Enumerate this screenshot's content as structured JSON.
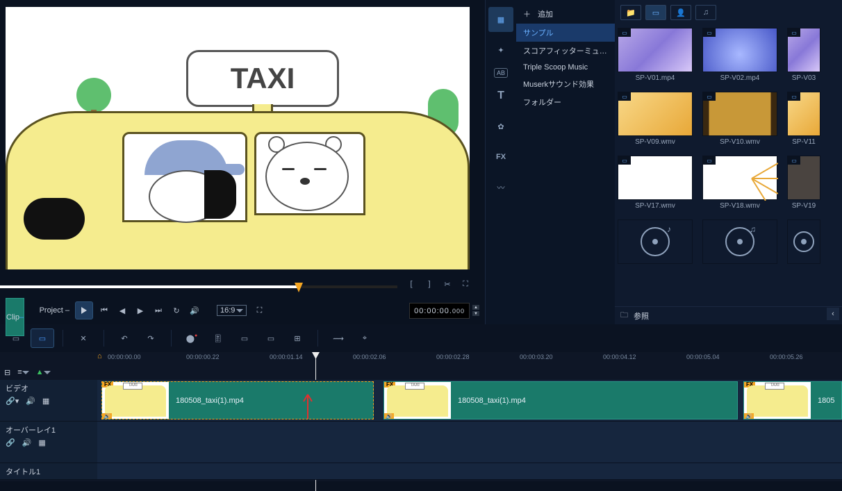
{
  "preview": {
    "taxi_sign": "TAXI",
    "project_label": "Project",
    "clip_label": "Clip",
    "aspect_ratio": "16:9",
    "timecode_main": "00:00:00.",
    "timecode_frac": "000"
  },
  "library": {
    "add_label": "追加",
    "browse_label": "参照",
    "tree": {
      "sample": "サンプル",
      "scorefitter": "スコアフィッターミュー...",
      "triplescoop": "Triple Scoop Music",
      "muserk": "Muserkサウンド効果",
      "folder": "フォルダー"
    },
    "thumbs": {
      "r1c1": "SP-V01.mp4",
      "r1c2": "SP-V02.mp4",
      "r1c3": "SP-V03",
      "r2c1": "SP-V09.wmv",
      "r2c2": "SP-V10.wmv",
      "r2c3": "SP-V11",
      "r3c1": "SP-V17.wmv",
      "r3c2": "SP-V18.wmv",
      "r3c3": "SP-V19"
    }
  },
  "timeline": {
    "ticks": {
      "t0": "00:00:00.00",
      "t1": "00:00:00.22",
      "t2": "00:00:01.14",
      "t3": "00:00:02.06",
      "t4": "00:00:02.28",
      "t5": "00:00:03.20",
      "t6": "00:00:04.12",
      "t7": "00:00:05.04",
      "t8": "00:00:05.26"
    },
    "tracks": {
      "video": "ビデオ",
      "overlay": "オーバーレイ1",
      "title": "タイトル1"
    },
    "clips": {
      "c1": "180508_taxi(1).mp4",
      "c2": "180508_taxi(1).mp4",
      "c3": "1805"
    }
  }
}
